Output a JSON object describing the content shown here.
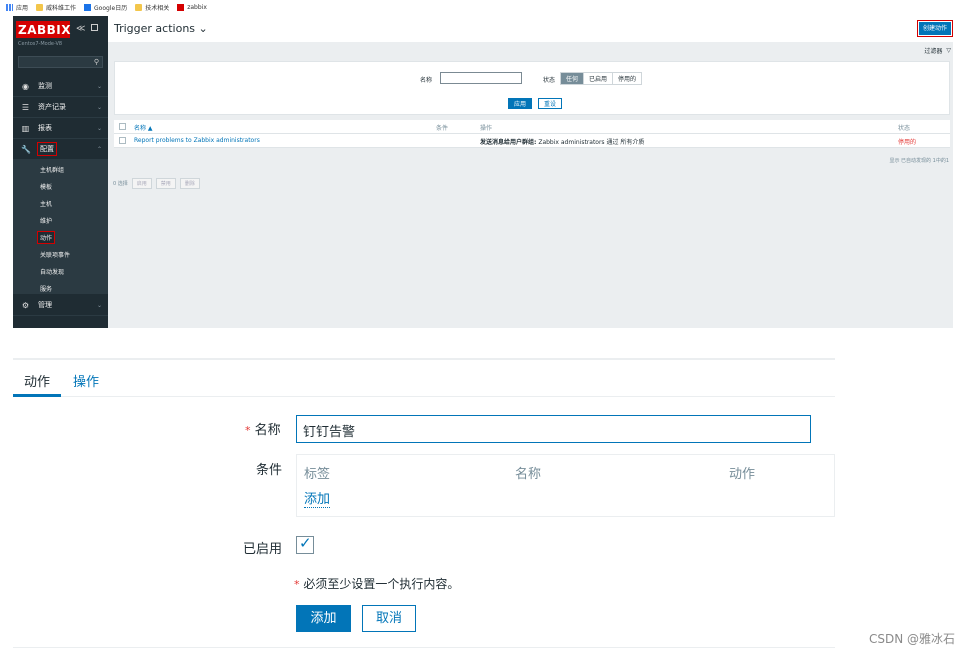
{
  "bookmarks": [
    {
      "label": "应用",
      "icon": "apps-icon"
    },
    {
      "label": "威科维工作",
      "icon": "folder-icon"
    },
    {
      "label": "Google日历",
      "icon": "calendar-icon"
    },
    {
      "label": "技术相关",
      "icon": "folder-icon"
    },
    {
      "label": "zabbix",
      "icon": "zabbix-icon"
    }
  ],
  "sidebar": {
    "logo": "ZABBIX",
    "server_name": "Centos7-Mode-V8",
    "search_placeholder": "",
    "items": [
      {
        "label": "监测",
        "icon": "eye-icon"
      },
      {
        "label": "资产记录",
        "icon": "list-icon"
      },
      {
        "label": "报表",
        "icon": "chart-icon"
      },
      {
        "label": "配置",
        "icon": "wrench-icon"
      },
      {
        "label": "管理",
        "icon": "gear-icon"
      }
    ],
    "submenu": [
      "主机群组",
      "模板",
      "主机",
      "维护",
      "动作",
      "关联项事件",
      "自动发现",
      "服务"
    ]
  },
  "header": {
    "title": "Trigger actions",
    "create_button": "创建动作"
  },
  "filter": {
    "tab_label": "过滤器",
    "name_label": "名称",
    "name_value": "",
    "status_label": "状态",
    "status_options": [
      "任何",
      "已启用",
      "停用的"
    ],
    "status_selected": "任何",
    "apply": "应用",
    "reset": "重设"
  },
  "table": {
    "headers": [
      "名称 ▲",
      "条件",
      "操作",
      "状态"
    ],
    "rows": [
      {
        "name": "Report problems to Zabbix administrators",
        "conditions": "",
        "operations_bold": "发送消息给用户群组:",
        "operations_rest": "Zabbix administrators 通过 所有介质",
        "status": "停用的"
      }
    ],
    "footer": "显示 已自动发现的 1中的1"
  },
  "bulk": {
    "selected": "0 选择",
    "buttons": [
      "启用",
      "禁用",
      "删除"
    ]
  },
  "form": {
    "tabs": [
      "动作",
      "操作"
    ],
    "name_label": "名称",
    "name_value": "钉钉告警",
    "conditions_label": "条件",
    "cond_headers": [
      "标签",
      "名称",
      "动作"
    ],
    "cond_add": "添加",
    "enabled_label": "已启用",
    "enabled": true,
    "warning": "必须至少设置一个执行内容。",
    "add_button": "添加",
    "cancel_button": "取消"
  },
  "watermark": "CSDN @雅冰石",
  "colors": {
    "accent": "#0275b8",
    "sidebar_bg": "#1f2c33",
    "logo_red": "#d40000",
    "status_disabled": "#e33734"
  }
}
